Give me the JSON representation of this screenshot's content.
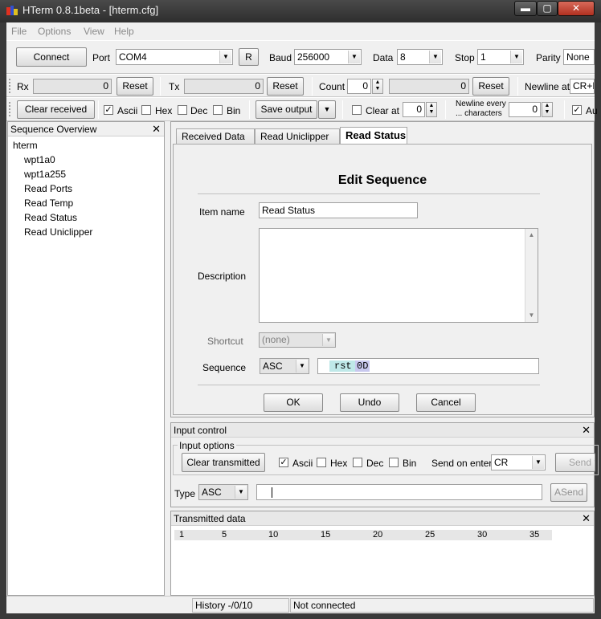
{
  "window": {
    "title": "HTerm 0.8.1beta - [hterm.cfg]",
    "min": "▬",
    "max": "▢",
    "close": "✕"
  },
  "menu": [
    "File",
    "Options",
    "View",
    "Help"
  ],
  "conn": {
    "connect": "Connect",
    "port_label": "Port",
    "port": "COM4",
    "r": "R",
    "baud_label": "Baud",
    "baud": "256000",
    "data_label": "Data",
    "data": "8",
    "stop_label": "Stop",
    "stop": "1",
    "parity_label": "Parity",
    "parity": "None"
  },
  "counters": {
    "rx_label": "Rx",
    "rx": "0",
    "rx_reset": "Reset",
    "tx_label": "Tx",
    "tx": "0",
    "tx_reset": "Reset",
    "count_label": "Count",
    "count": "0",
    "count_val": "0",
    "count_reset": "Reset",
    "newline_label": "Newline at",
    "newline": "CR+L"
  },
  "display": {
    "clear_received": "Clear received",
    "ascii": "Ascii",
    "hex": "Hex",
    "dec": "Dec",
    "bin": "Bin",
    "save_output": "Save output",
    "clear_at": "Clear at",
    "clear_at_val": "0",
    "newline_every_1": "Newline every",
    "newline_every_2": "... characters",
    "newline_every_val": "0",
    "au": "Au"
  },
  "sequence_overview": {
    "title": "Sequence Overview",
    "root": "hterm",
    "items": [
      "wpt1a0",
      "wpt1a255",
      "Read Ports",
      "Read Temp",
      "Read Status",
      "Read Uniclipper"
    ]
  },
  "tabs": [
    "Received Data",
    "Read Uniclipper",
    "Read Status"
  ],
  "edit": {
    "heading": "Edit Sequence",
    "name_label": "Item name",
    "name": "Read Status",
    "desc_label": "Description",
    "shortcut_label": "Shortcut",
    "shortcut": "(none)",
    "seq_label": "Sequence",
    "seq_mode": "ASC",
    "seq_text": "rst",
    "seq_hex": "0D",
    "ok": "OK",
    "undo": "Undo",
    "cancel": "Cancel"
  },
  "input_control": {
    "title": "Input control",
    "group": "Input options",
    "clear_transmitted": "Clear transmitted",
    "ascii": "Ascii",
    "hex": "Hex",
    "dec": "Dec",
    "bin": "Bin",
    "send_on_enter": "Send on enter",
    "send_on_enter_val": "CR",
    "send_f": "Send f",
    "type_label": "Type",
    "type": "ASC",
    "asend": "ASend"
  },
  "transmitted": {
    "title": "Transmitted data",
    "ruler": [
      "1",
      "5",
      "10",
      "15",
      "20",
      "25",
      "30",
      "35"
    ]
  },
  "status": {
    "history": "History -/0/10",
    "connection": "Not connected"
  },
  "colors": {
    "seq_text_bg": "#bfe8e8",
    "seq_hex_bg": "#c8c8ee",
    "chrome": "#3a3a3a"
  }
}
